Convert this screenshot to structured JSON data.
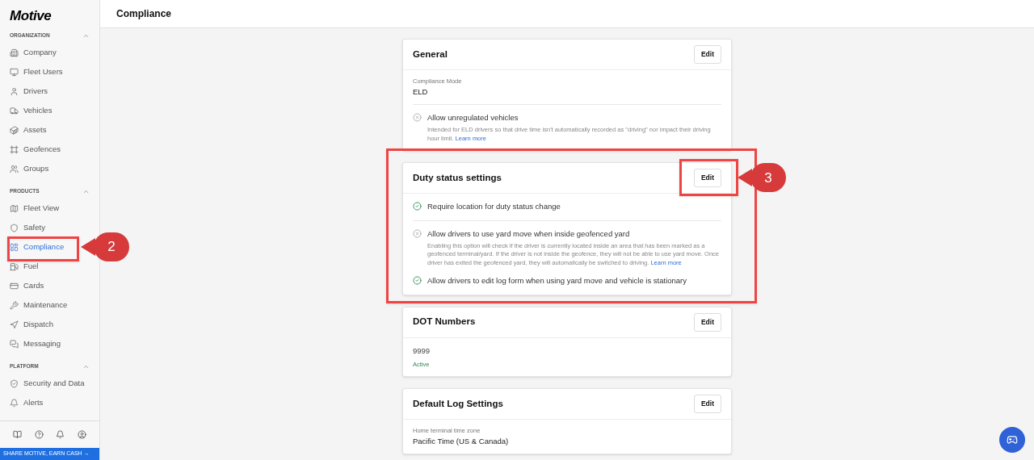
{
  "sidebar": {
    "logo": "Motive",
    "sections": [
      {
        "title": "ORGANIZATION",
        "expanded": true,
        "items": [
          {
            "label": "Company",
            "selected": false
          },
          {
            "label": "Fleet Users",
            "selected": false
          },
          {
            "label": "Drivers",
            "selected": false
          },
          {
            "label": "Vehicles",
            "selected": false
          },
          {
            "label": "Assets",
            "selected": false
          },
          {
            "label": "Geofences",
            "selected": false
          },
          {
            "label": "Groups",
            "selected": false
          }
        ]
      },
      {
        "title": "PRODUCTS",
        "expanded": true,
        "items": [
          {
            "label": "Fleet View",
            "selected": false
          },
          {
            "label": "Safety",
            "selected": false
          },
          {
            "label": "Compliance",
            "selected": true,
            "callout": "2"
          },
          {
            "label": "Fuel",
            "selected": false
          },
          {
            "label": "Cards",
            "selected": false
          },
          {
            "label": "Maintenance",
            "selected": false
          },
          {
            "label": "Dispatch",
            "selected": false
          },
          {
            "label": "Messaging",
            "selected": false
          }
        ]
      },
      {
        "title": "PLATFORM",
        "expanded": true,
        "items": [
          {
            "label": "Security and Data",
            "selected": false
          },
          {
            "label": "Alerts",
            "selected": false
          }
        ]
      }
    ],
    "share_banner": "SHARE MOTIVE, EARN CASH →"
  },
  "header": {
    "title": "Compliance"
  },
  "cards": [
    {
      "title": "General",
      "edit_label": "Edit",
      "groups": [
        [
          {
            "kind": "field",
            "label": "Compliance Mode",
            "value": "ELD"
          }
        ],
        [
          {
            "kind": "setting",
            "label": "Allow unregulated vehicles",
            "enabled": false,
            "description": "Intended for ELD drivers so that drive time isn't automatically recorded as \"driving\" nor impact their driving hour limit.",
            "link": "Learn more"
          }
        ]
      ]
    },
    {
      "title": "Duty status settings",
      "edit_label": "Edit",
      "edit_callout": "3",
      "groups": [
        [
          {
            "kind": "setting",
            "label": "Require location for duty status change",
            "enabled": true
          }
        ],
        [
          {
            "kind": "setting",
            "label": "Allow drivers to use yard move when inside geofenced yard",
            "enabled": false,
            "description": "Enabling this option will check if the driver is currently located inside an area that has been marked as a geofenced terminal/yard. If the driver is not inside the geofence, they will not be able to use yard move. Once driver has exited the geofenced yard, they will automatically be switched to driving.",
            "link": "Learn more"
          },
          {
            "kind": "setting",
            "label": "Allow drivers to edit log form when using yard move and vehicle is stationary",
            "enabled": true
          }
        ]
      ]
    },
    {
      "title": "DOT Numbers",
      "edit_label": "Edit",
      "groups": [
        [
          {
            "kind": "dot",
            "number": "9999",
            "status": "Active"
          }
        ]
      ]
    },
    {
      "title": "Default Log Settings",
      "edit_label": "Edit",
      "groups": [
        [
          {
            "kind": "field",
            "label": "Home terminal time zone",
            "value": "Pacific Time (US & Canada)"
          }
        ]
      ]
    }
  ]
}
